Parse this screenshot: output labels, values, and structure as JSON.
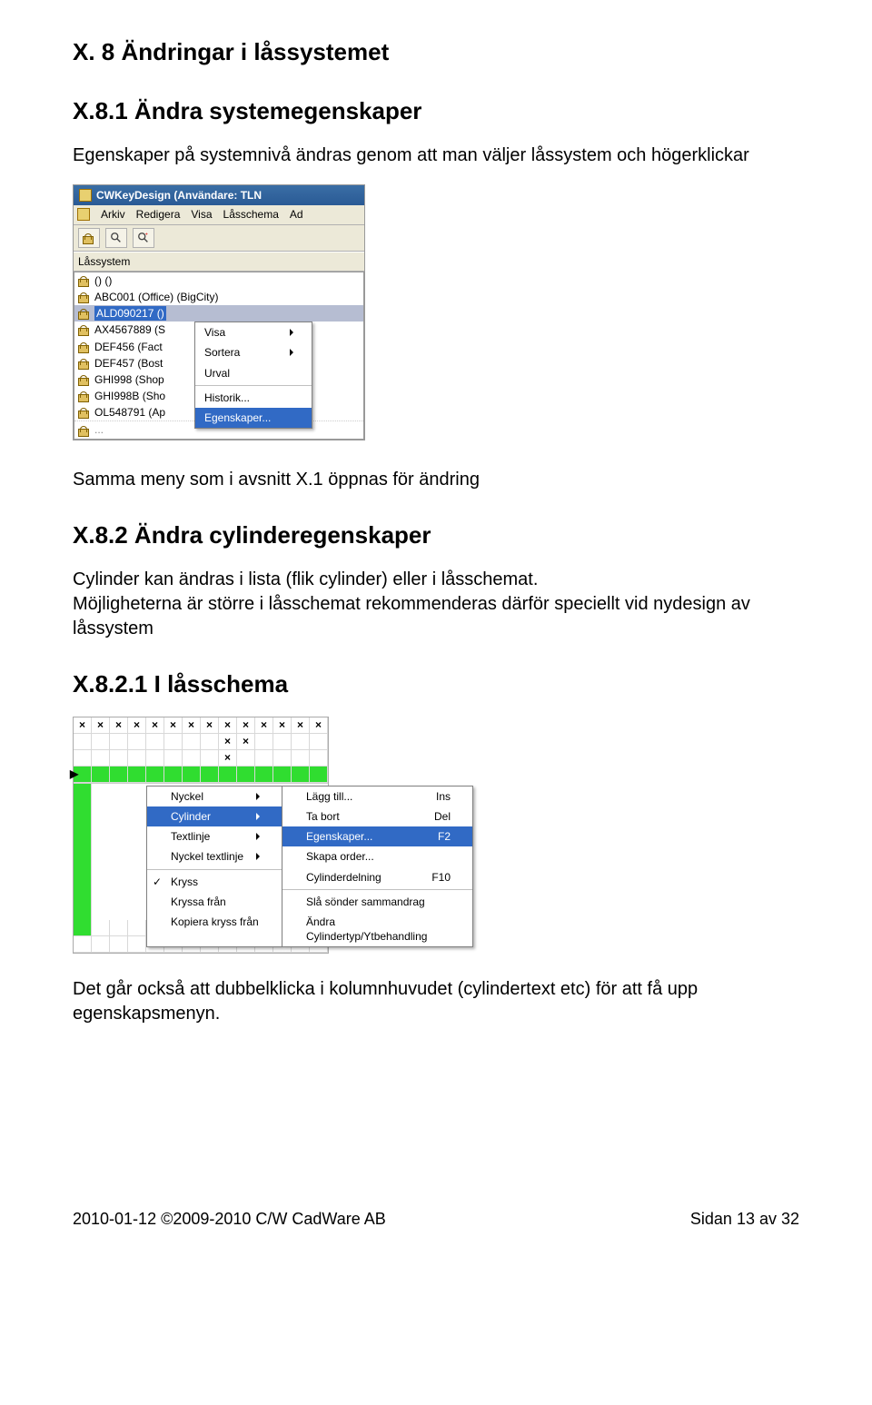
{
  "headings": {
    "h1": "X. 8 Ändringar i låssystemet",
    "h2": "X.8.1 Ändra systemegenskaper",
    "h3": "X.8.2 Ändra cylinderegenskaper",
    "h4": "X.8.2.1 I låsschema"
  },
  "body": {
    "p1": "Egenskaper på systemnivå ändras genom att man väljer låssystem och högerklickar",
    "p2": "Samma meny som i avsnitt X.1 öppnas för ändring",
    "p3a": "Cylinder kan ändras i lista (flik cylinder) eller i låsschemat.",
    "p3b": "Möjligheterna är större i låsschemat rekommenderas därför speciellt vid nydesign av låssystem",
    "p4": "Det går också att dubbelklicka i kolumnhuvudet (cylindertext etc) för att få upp egenskapsmenyn."
  },
  "screenshot1": {
    "title": "CWKeyDesign    (Användare: TLN",
    "menubar": [
      "Arkiv",
      "Redigera",
      "Visa",
      "Låsschema",
      "Ad"
    ],
    "panel_label": "Låssystem",
    "tree_items": [
      "() ()",
      "ABC001 (Office) (BigCity)",
      "ALD090217 ()",
      "AX4567889 (S",
      "DEF456 (Fact",
      "DEF457 (Bost",
      "GHI998 (Shop",
      "GHI998B (Sho",
      "OL548791 (Ap"
    ],
    "context_menu": [
      {
        "label": "Visa",
        "arrow": true
      },
      {
        "label": "Sortera",
        "arrow": true
      },
      {
        "label": "Urval"
      },
      {
        "sep": true
      },
      {
        "label": "Historik..."
      },
      {
        "label": "Egenskaper...",
        "selected": true
      }
    ]
  },
  "screenshot2": {
    "ctx_left": [
      {
        "label": "Nyckel",
        "arrow": true
      },
      {
        "label": "Cylinder",
        "arrow": true,
        "selected": true
      },
      {
        "label": "Textlinje",
        "arrow": true
      },
      {
        "label": "Nyckel textlinje",
        "arrow": true
      },
      {
        "sep": true
      },
      {
        "label": "Kryss",
        "checked": true
      },
      {
        "label": "Kryssa från"
      },
      {
        "label": "Kopiera kryss från"
      }
    ],
    "ctx_right": [
      {
        "label": "Lägg till...",
        "shortcut": "Ins"
      },
      {
        "label": "Ta bort",
        "shortcut": "Del"
      },
      {
        "label": "Egenskaper...",
        "shortcut": "F2",
        "selected": true
      },
      {
        "label": "Skapa order..."
      },
      {
        "label": "Cylinderdelning",
        "shortcut": "F10"
      },
      {
        "sep": true
      },
      {
        "label": "Slå sönder sammandrag"
      },
      {
        "label": "Ändra Cylindertyp/Ytbehandling"
      }
    ]
  },
  "footer": {
    "left": "2010-01-12  ©2009-2010 C/W CadWare AB",
    "right": "Sidan 13 av 32"
  }
}
